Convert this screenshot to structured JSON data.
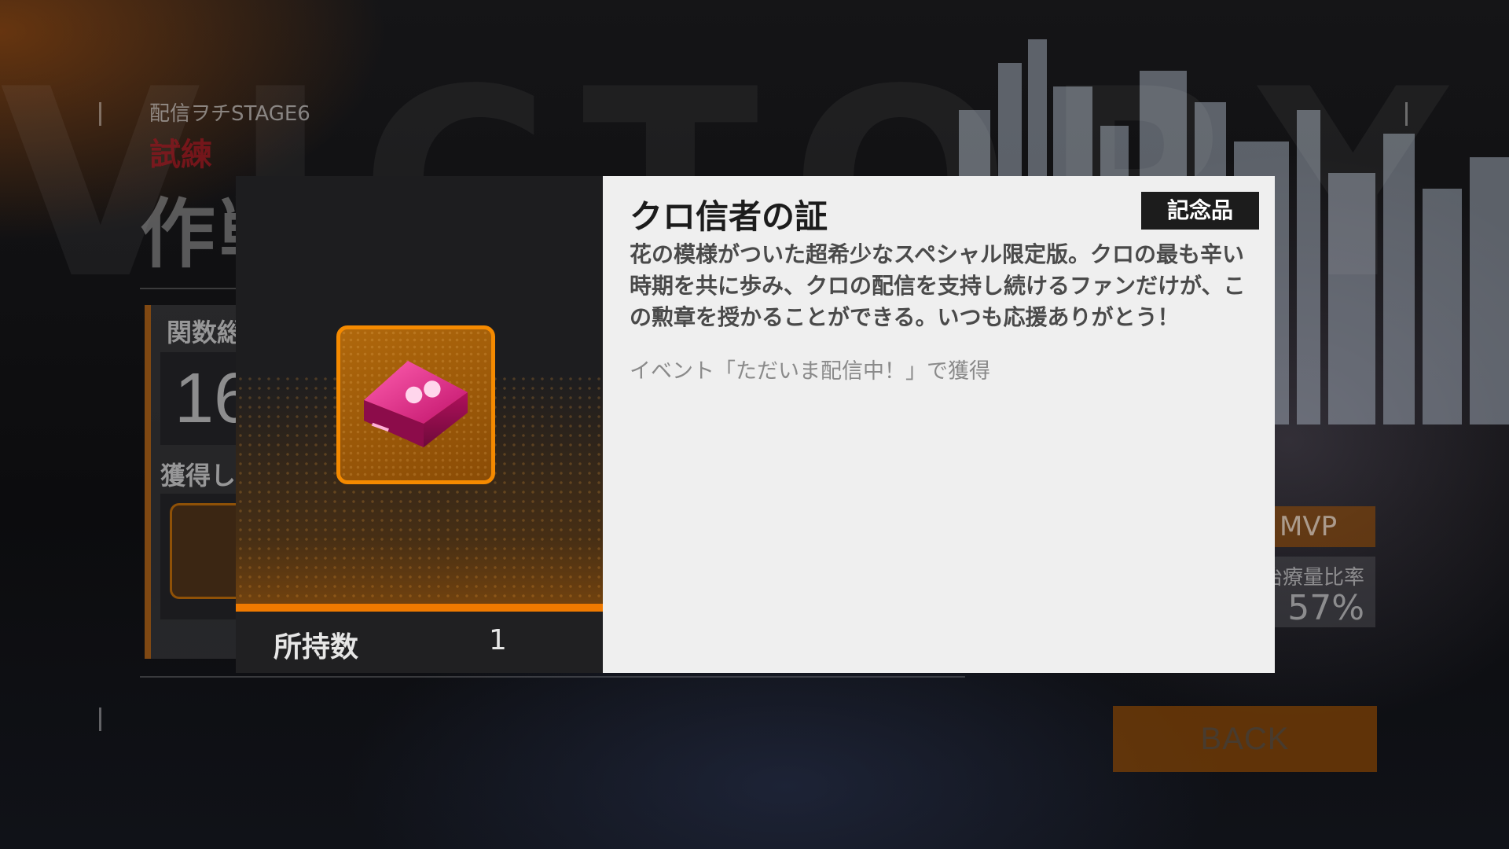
{
  "background": {
    "watermark_text": "VICTORY",
    "stage_label": "配信ヲチSTAGE6",
    "stage_sub": "試練",
    "result_title": "作戦成功",
    "stat_label": "関数総",
    "stat_value": "16",
    "obtained_label": "獲得し",
    "mvp_label": "MVP",
    "heal_label": "治療量比率",
    "heal_value": "57%",
    "back_button": "BACK"
  },
  "item_detail": {
    "name": "クロ信者の証",
    "category": "記念品",
    "description": "花の模様がついた超希少なスペシャル限定版。クロの最も辛い時期を共に歩み、クロの配信を支持し続けるファンだけが、この勲章を授かることができる。いつも応援ありがとう！",
    "source": "イベント「ただいま配信中！」で獲得",
    "count_label": "所持数",
    "count_value": "1",
    "icon": "keycap-medal-icon",
    "frame_color": "#f58a00"
  }
}
